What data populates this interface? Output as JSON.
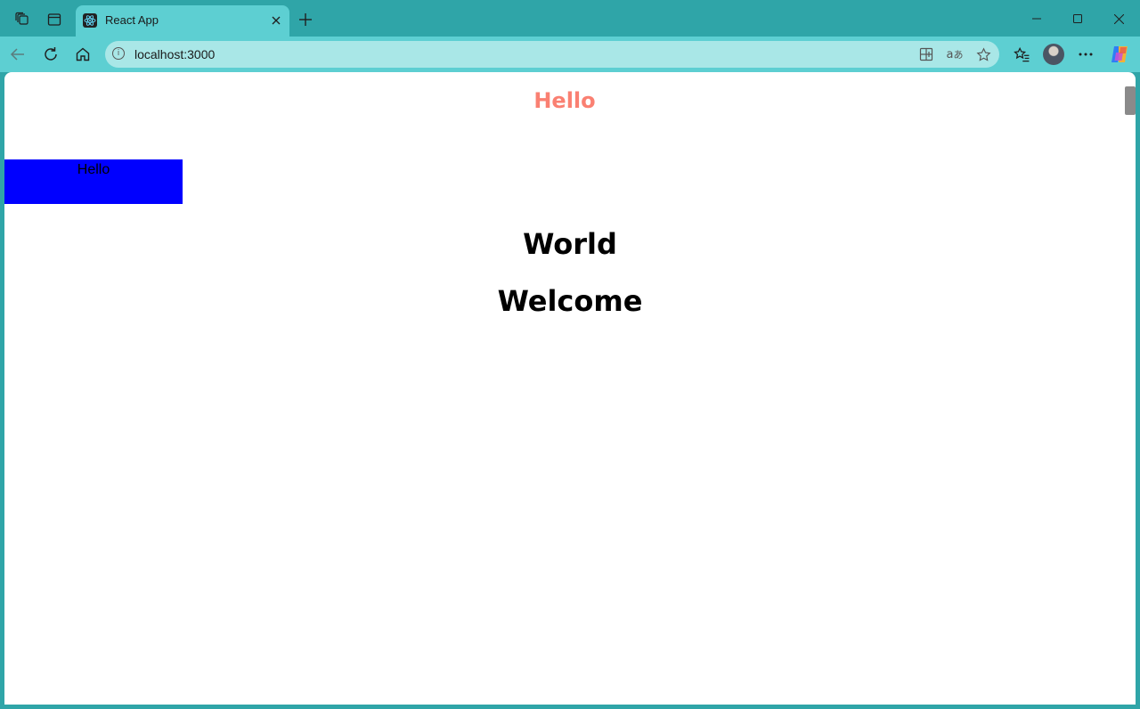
{
  "browser": {
    "tab": {
      "title": "React App",
      "favicon": "react-atom-icon"
    },
    "address_bar": {
      "url": "localhost:3000"
    },
    "theme_colors": {
      "frame": "#2fa5a8",
      "toolbar": "#5dcfd2",
      "omnibox": "#a9e7e7"
    }
  },
  "page": {
    "heading_hello": "Hello",
    "box_text": "Hello",
    "heading_world": "World",
    "heading_welcome": "Welcome",
    "colors": {
      "heading_hello": "#fa8072",
      "box_background": "#0000ff",
      "text": "#000000"
    }
  }
}
